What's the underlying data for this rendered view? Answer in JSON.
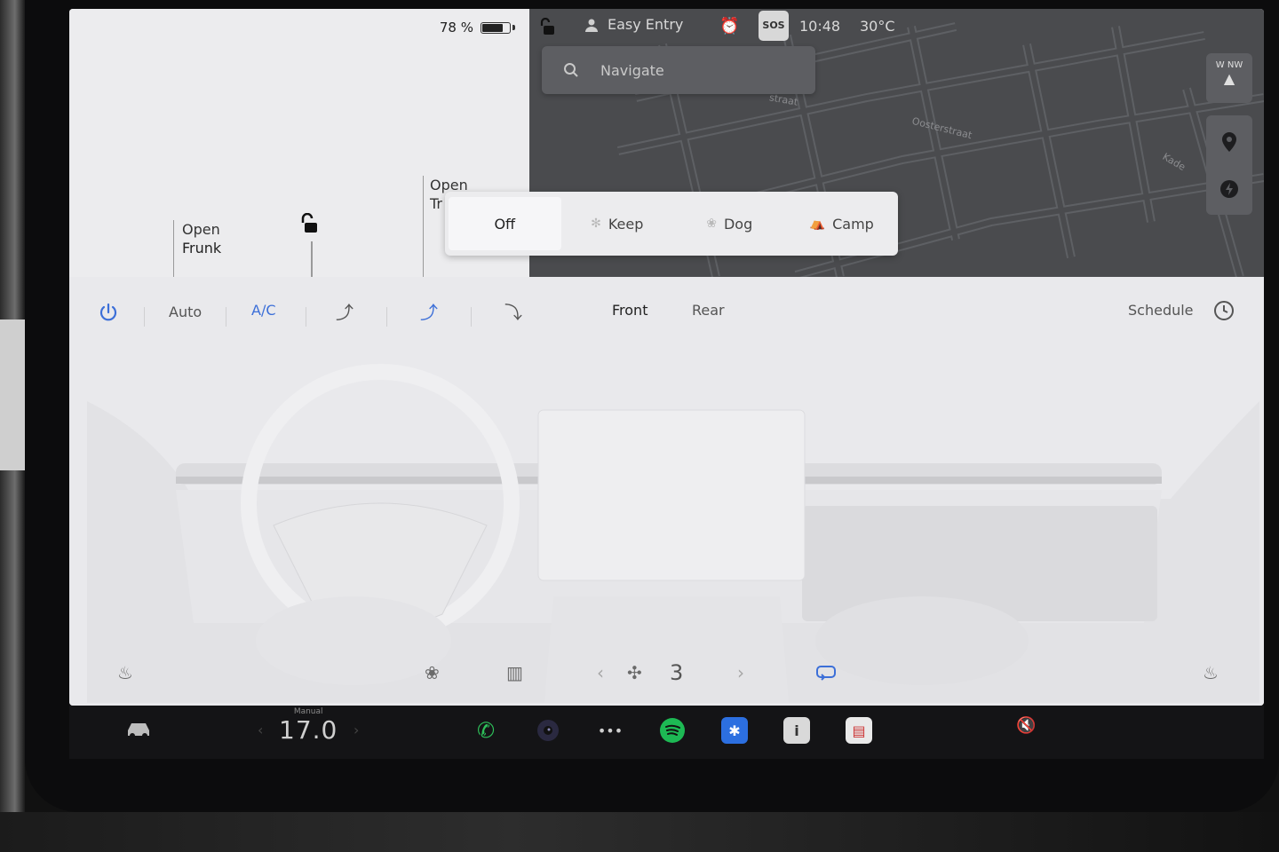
{
  "car": {
    "battery_percent": "78 %",
    "battery_level": 0.78,
    "frunk_label_line1": "Open",
    "frunk_label_line2": "Frunk",
    "trunk_label_line1": "Open",
    "trunk_label_line2": "Tr"
  },
  "status_bar": {
    "profile_name": "Easy Entry",
    "sos_label": "SOS",
    "time": "10:48",
    "outside_temp": "30°C"
  },
  "map": {
    "search_placeholder": "Navigate",
    "compass_label": "W NW",
    "street_labels": [
      "Oosterstraat",
      "Kade",
      "straat"
    ]
  },
  "keep_climate": {
    "options": [
      {
        "label": "Off",
        "selected": true,
        "icon": ""
      },
      {
        "label": "Keep",
        "selected": false,
        "icon": "fan-icon"
      },
      {
        "label": "Dog",
        "selected": false,
        "icon": "paw-icon"
      },
      {
        "label": "Camp",
        "selected": false,
        "icon": "tent-icon"
      }
    ]
  },
  "climate": {
    "auto_label": "Auto",
    "ac_label": "A/C",
    "front_label": "Front",
    "rear_label": "Rear",
    "schedule_label": "Schedule",
    "fan_speed": "3",
    "accent_color": "#3c6fd8"
  },
  "taskbar": {
    "temp_mode": "Manual",
    "temp_value": "17.0",
    "apps": [
      "phone-icon",
      "camera-icon",
      "more-icon",
      "spotify-icon",
      "bluetooth-icon",
      "manual-icon",
      "notes-icon"
    ]
  }
}
